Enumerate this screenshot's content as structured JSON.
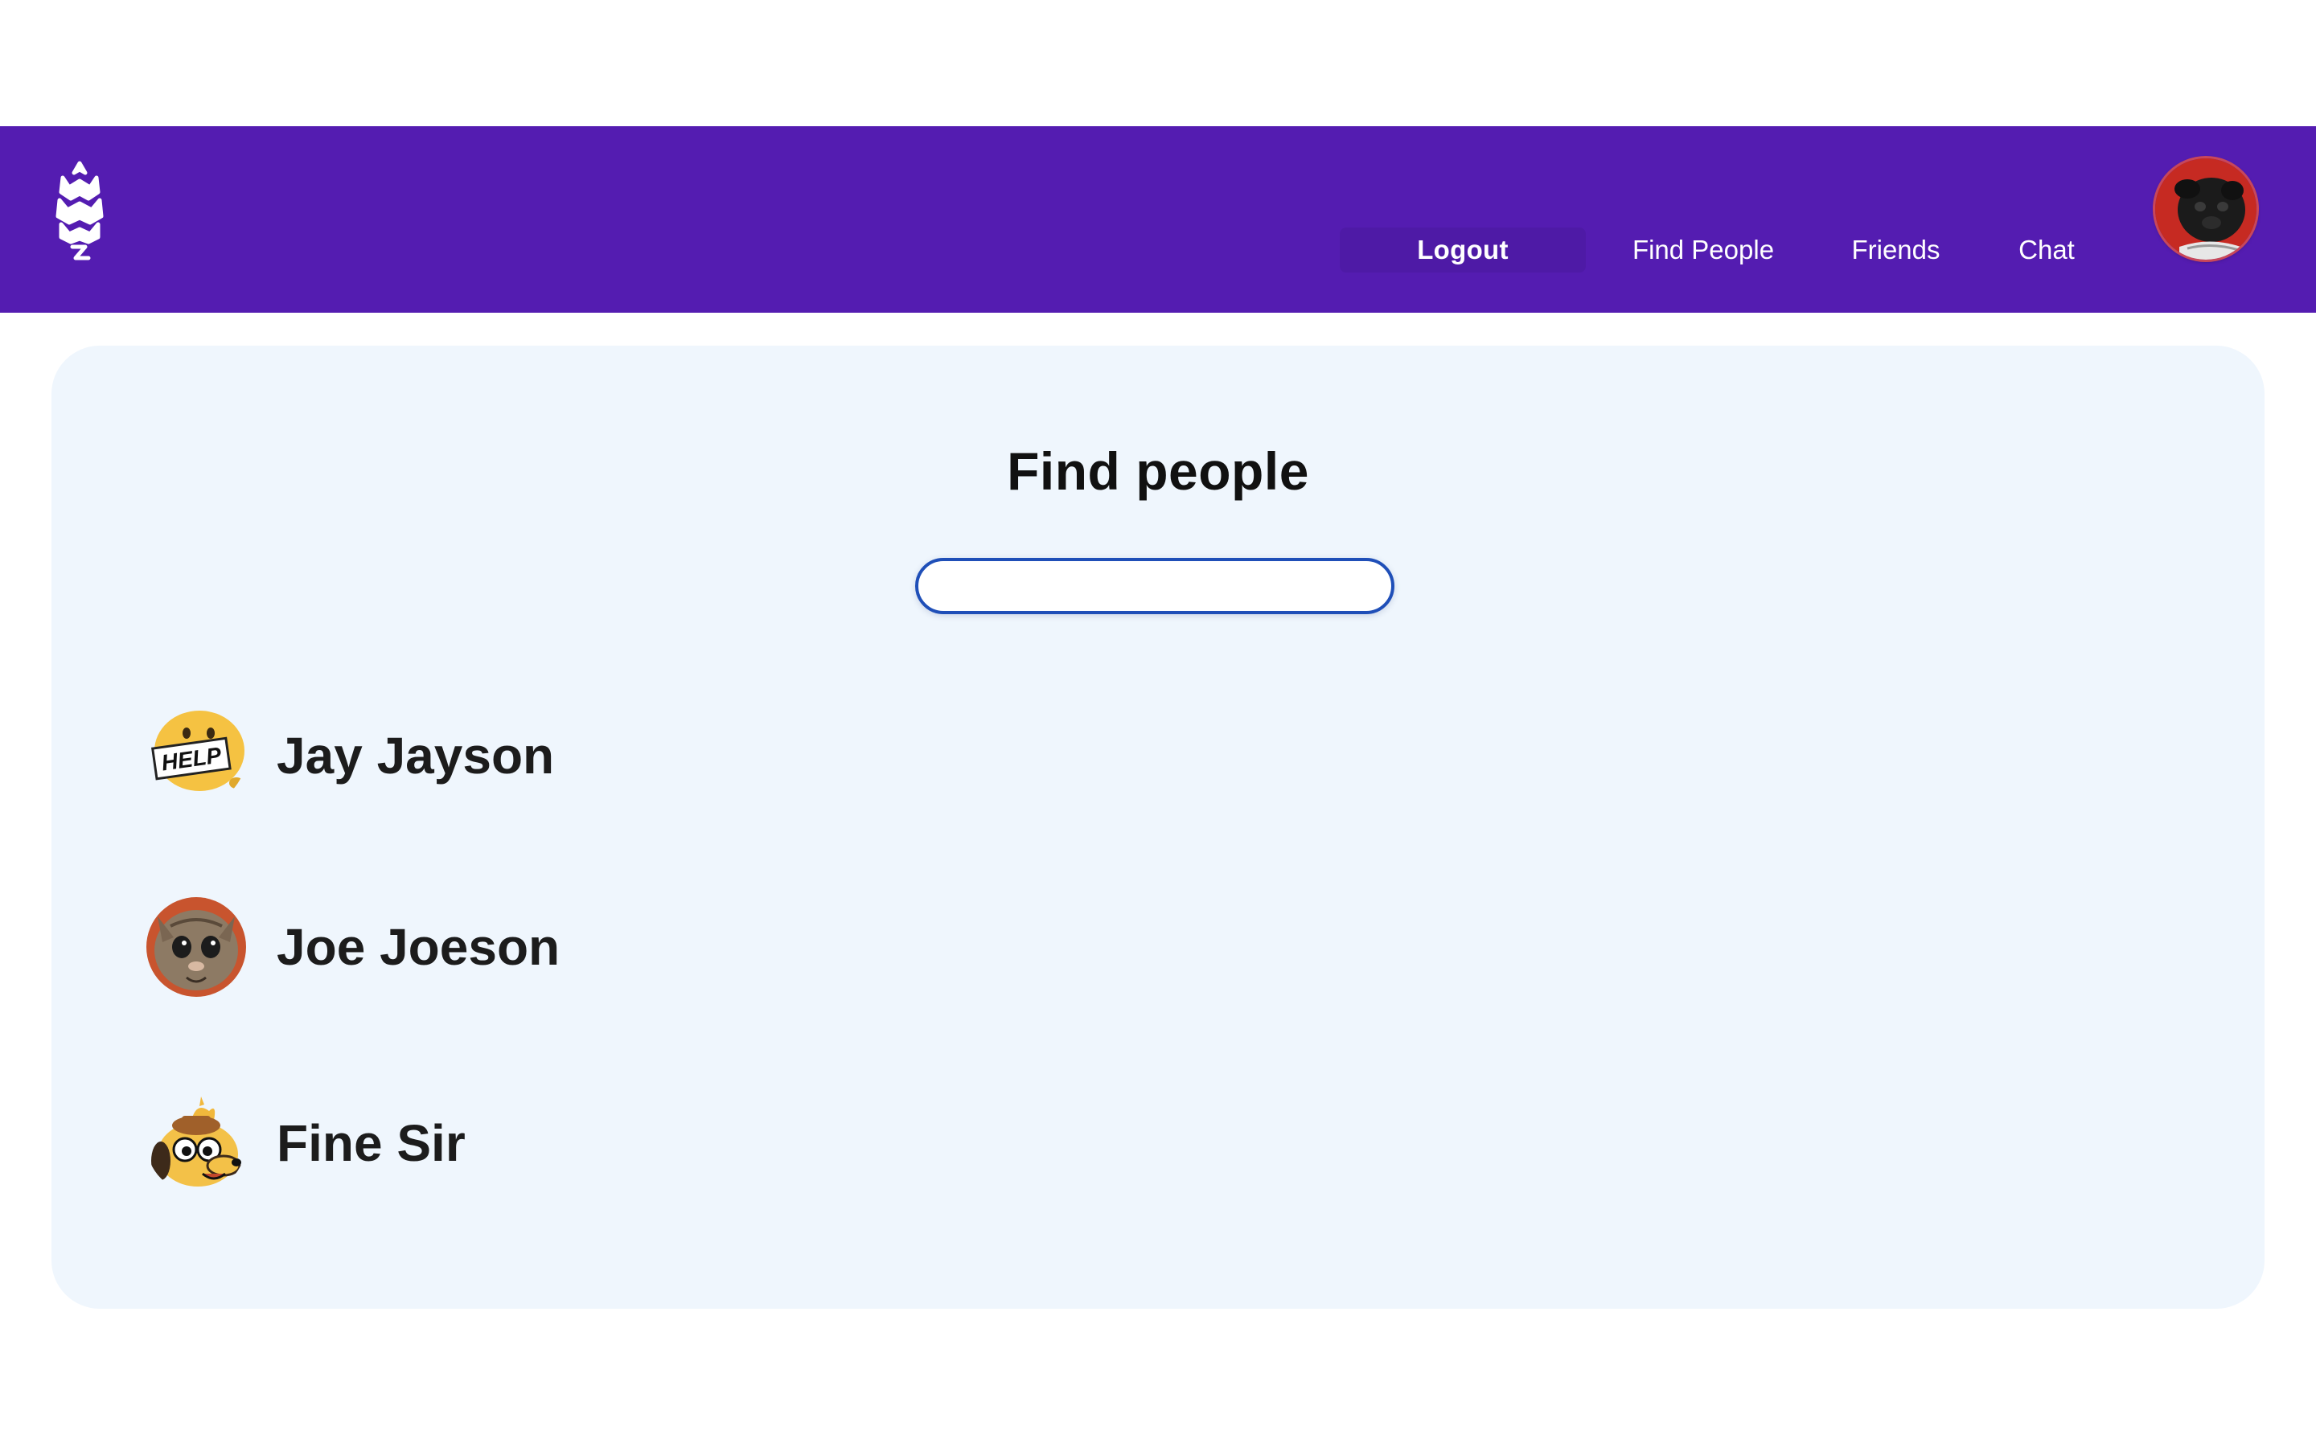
{
  "nav": {
    "logo_icon": "wheat-flame-logo-icon",
    "links": [
      "Logout",
      "Find People",
      "Friends",
      "Chat"
    ],
    "avatar_icon": "pug-avatar-icon"
  },
  "main": {
    "title": "Find people",
    "search": {
      "value": "",
      "placeholder": ""
    },
    "people": [
      {
        "name": "Jay Jayson",
        "avatar_icon": "help-sign-emoji-avatar-icon"
      },
      {
        "name": "Joe Joeson",
        "avatar_icon": "cat-photo-avatar-icon"
      },
      {
        "name": "Fine Sir",
        "avatar_icon": "dog-this-is-fine-avatar-icon"
      }
    ]
  },
  "colors": {
    "navbar": "#541cb1",
    "card": "#eff6fd",
    "search_border": "#1f4fb8"
  }
}
